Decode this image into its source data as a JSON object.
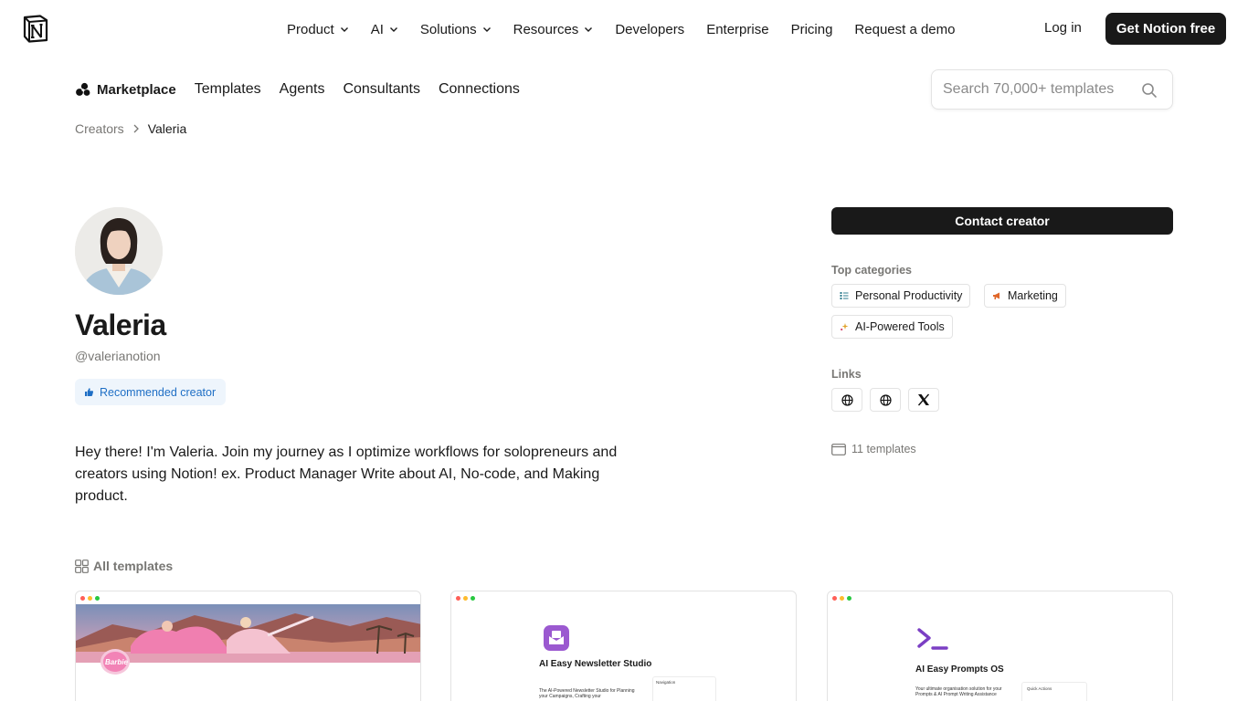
{
  "nav": {
    "items": [
      {
        "label": "Product",
        "dropdown": true
      },
      {
        "label": "AI",
        "dropdown": true
      },
      {
        "label": "Solutions",
        "dropdown": true
      },
      {
        "label": "Resources",
        "dropdown": true
      },
      {
        "label": "Developers",
        "dropdown": false
      },
      {
        "label": "Enterprise",
        "dropdown": false
      },
      {
        "label": "Pricing",
        "dropdown": false
      },
      {
        "label": "Request a demo",
        "dropdown": false
      }
    ],
    "login": "Log in",
    "cta": "Get Notion free"
  },
  "marketplace": {
    "brand": "Marketplace",
    "tabs": [
      "Templates",
      "Agents",
      "Consultants",
      "Connections"
    ],
    "search_placeholder": "Search 70,000+ templates"
  },
  "breadcrumb": {
    "parent": "Creators",
    "current": "Valeria"
  },
  "profile": {
    "name": "Valeria",
    "handle": "@valerianotion",
    "badge": "Recommended creator",
    "bio": "Hey there! I'm Valeria. Join my journey as I optimize workflows for solopreneurs and creators using Notion! ex. Product Manager Write about AI, No-code, and Making product."
  },
  "sidebar": {
    "contact": "Contact creator",
    "top_categories_label": "Top categories",
    "categories": [
      {
        "label": "Personal Productivity",
        "icon": "checklist-icon",
        "color": "#2f7d8f"
      },
      {
        "label": "Marketing",
        "icon": "megaphone-icon",
        "color": "#e0672a"
      },
      {
        "label": "AI-Powered Tools",
        "icon": "sparkle-icon",
        "color": "#e0a22a"
      }
    ],
    "links_label": "Links",
    "links": [
      {
        "icon": "globe-icon"
      },
      {
        "icon": "globe-icon"
      },
      {
        "icon": "x-logo-icon"
      }
    ],
    "templates_count": "11 templates"
  },
  "templates": {
    "label": "All templates",
    "cards": [
      {
        "title": "",
        "subtitle": "",
        "badge_text": "Barbie"
      },
      {
        "title": "AI Easy Newsletter Studio",
        "subtitle": "The AI-Powered Newsletter Studio for Planning your Campaigns, Crafting your",
        "panel_text": "Navigation"
      },
      {
        "title": "AI Easy Prompts OS",
        "subtitle": "Your ultimate organisation solution for your Prompts & AI Prompt Writing Assistance",
        "panel_text": "Quick Actions"
      }
    ]
  },
  "colors": {
    "primary_button": "#191919",
    "badge_bg": "#eef5fc",
    "badge_text": "#1f6fc5",
    "newsletter_icon": "#9b59d0",
    "prompts_icon": "#7b3fc4"
  }
}
